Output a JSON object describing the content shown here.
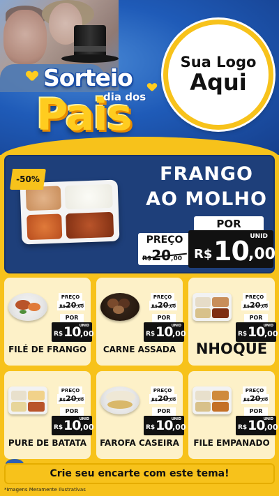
{
  "header": {
    "brand_line1": "Sorteio",
    "brand_line2": "dia dos",
    "brand_line3": "Pais",
    "logo_line1": "Sua Logo",
    "logo_line2": "Aqui"
  },
  "featured": {
    "badge": "-50%",
    "title_line1": "FRANGO",
    "title_line2": "AO MOLHO",
    "por_label": "POR",
    "preco_label": "PREÇO",
    "old_currency": "R$",
    "old_int": "20",
    "old_dec": ",00",
    "unit": "UNID",
    "currency": "R$",
    "price_int": "10",
    "price_dec": ",00"
  },
  "products": [
    {
      "name": "FILÉ DE FRANGO",
      "preco_label": "PREÇO",
      "old_currency": "R$",
      "old_int": "20",
      "old_dec": ",00",
      "por_label": "POR",
      "unit": "UNID",
      "currency": "R$",
      "price_int": "10",
      "price_dec": ",00"
    },
    {
      "name": "CARNE ASSADA",
      "preco_label": "PREÇO",
      "old_currency": "R$",
      "old_int": "20",
      "old_dec": ",00",
      "por_label": "POR",
      "unit": "UNID",
      "currency": "R$",
      "price_int": "10",
      "price_dec": ",00"
    },
    {
      "name": "NHOQUE",
      "preco_label": "PREÇO",
      "old_currency": "R$",
      "old_int": "20",
      "old_dec": ",00",
      "por_label": "POR",
      "unit": "UNID",
      "currency": "R$",
      "price_int": "10",
      "price_dec": ",00"
    },
    {
      "name": "PURE DE BATATA",
      "preco_label": "PREÇO",
      "old_currency": "R$",
      "old_int": "20",
      "old_dec": ",00",
      "por_label": "POR",
      "unit": "UNID",
      "currency": "R$",
      "price_int": "10",
      "price_dec": ",00"
    },
    {
      "name": "FAROFA CASEIRA",
      "preco_label": "PREÇO",
      "old_currency": "R$",
      "old_int": "20",
      "old_dec": ",00",
      "por_label": "POR",
      "unit": "UNID",
      "currency": "R$",
      "price_int": "10",
      "price_dec": ",00"
    },
    {
      "name": "FILE EMPANADO",
      "preco_label": "PREÇO",
      "old_currency": "R$",
      "old_int": "20",
      "old_dec": ",00",
      "por_label": "POR",
      "unit": "UNID",
      "currency": "R$",
      "price_int": "10",
      "price_dec": ",00"
    }
  ],
  "footer": {
    "cta": "Crie seu encarte com este tema!",
    "disclaimer": "*Imagens Meramente Ilustrativas"
  },
  "colors": {
    "accent_yellow": "#f7c21b",
    "header_blue": "#1f5bb8",
    "featured_navy": "#1e3f7a",
    "card_cream": "#fdf1c8",
    "price_black": "#111111"
  }
}
